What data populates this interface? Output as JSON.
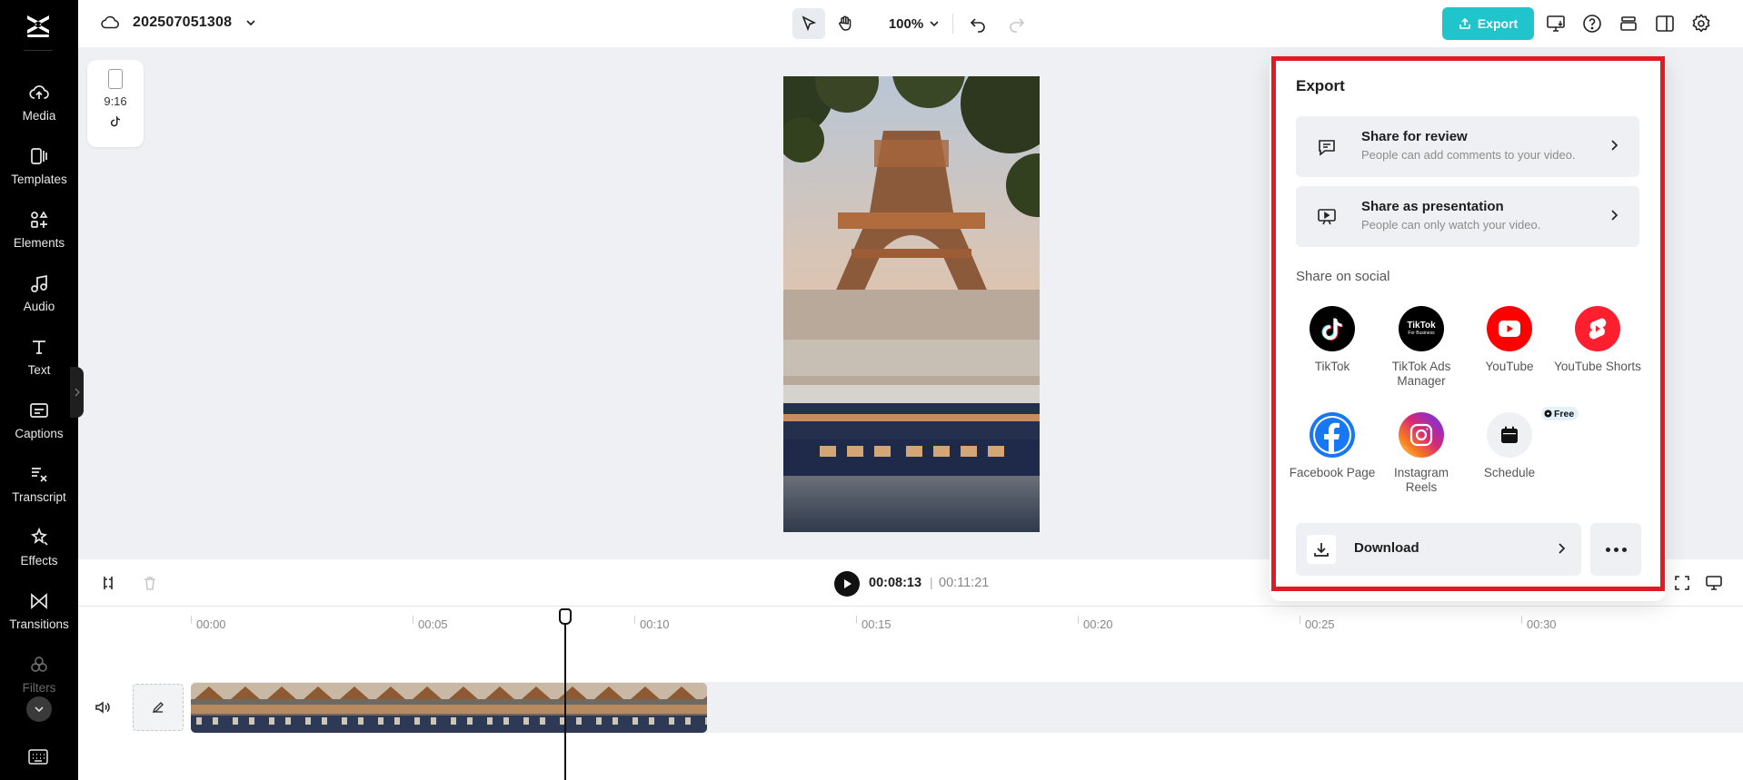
{
  "project": {
    "name": "202507051308"
  },
  "toolbar": {
    "zoom": "100%",
    "export_label": "Export"
  },
  "sidebar": {
    "items": [
      {
        "label": "Media"
      },
      {
        "label": "Templates"
      },
      {
        "label": "Elements"
      },
      {
        "label": "Audio"
      },
      {
        "label": "Text"
      },
      {
        "label": "Captions"
      },
      {
        "label": "Transcript"
      },
      {
        "label": "Effects"
      },
      {
        "label": "Transitions"
      },
      {
        "label": "Filters"
      }
    ]
  },
  "canvas": {
    "aspect_ratio": "9:16"
  },
  "player": {
    "current_time": "00:08:13",
    "separator": "|",
    "total_time": "00:11:21"
  },
  "timeline": {
    "ticks": [
      "00:00",
      "00:05",
      "00:10",
      "00:15",
      "00:20",
      "00:25",
      "00:30"
    ]
  },
  "export_panel": {
    "title": "Export",
    "share_review": {
      "title": "Share for review",
      "subtitle": "People can add comments to your video."
    },
    "share_presentation": {
      "title": "Share as presentation",
      "subtitle": "People can only watch your video."
    },
    "social_title": "Share on social",
    "social": [
      {
        "label": "TikTok"
      },
      {
        "label": "TikTok Ads Manager",
        "logo_text": "TikTok",
        "logo_sub": "For Business"
      },
      {
        "label": "YouTube"
      },
      {
        "label": "YouTube Shorts"
      },
      {
        "label": "Facebook Page"
      },
      {
        "label": "Instagram Reels"
      },
      {
        "label": "Schedule",
        "badge": "Free"
      }
    ],
    "download_label": "Download"
  },
  "colors": {
    "accent": "#20c4cb",
    "highlight": "#e01b24",
    "youtube": "#ff0000",
    "facebook": "#1877f2"
  }
}
